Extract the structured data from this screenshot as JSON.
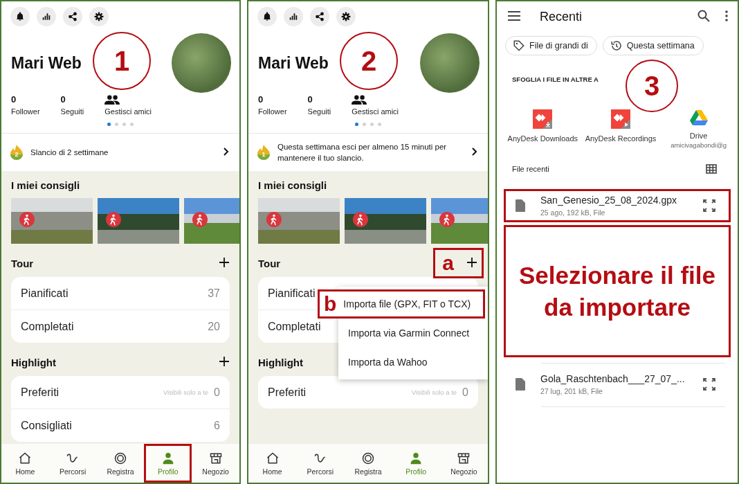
{
  "panels": [
    {
      "kind": "profile",
      "step": "1",
      "name": "Mari Web",
      "stats": [
        {
          "value": "0",
          "label": "Follower"
        },
        {
          "value": "0",
          "label": "Seguiti"
        }
      ],
      "friends": "Gestisci amici",
      "pager": [
        {
          "selected": true
        },
        {
          "selected": false
        },
        {
          "selected": false
        },
        {
          "selected": false
        }
      ],
      "streak": {
        "badge": "2",
        "text": "Slancio di 2 settimane"
      },
      "recommendations_title": "I miei consigli",
      "sections": [
        {
          "title": "Tour",
          "add_button": true,
          "rows": [
            {
              "label": "Pianificati",
              "count": "37"
            },
            {
              "label": "Completati",
              "count": "20"
            }
          ]
        },
        {
          "title": "Highlight",
          "add_button": true,
          "rows": [
            {
              "label": "Preferiti",
              "note": "Visibili solo a te",
              "count": "0"
            },
            {
              "label": "Consigliati",
              "count": "6"
            }
          ]
        }
      ],
      "nav": [
        {
          "label": "Home",
          "selected": false,
          "annotated": false
        },
        {
          "label": "Percorsi",
          "selected": false,
          "annotated": false
        },
        {
          "label": "Registra",
          "selected": false,
          "annotated": false
        },
        {
          "label": "Profilo",
          "selected": true,
          "annotated": true
        },
        {
          "label": "Negozio",
          "selected": false,
          "annotated": false
        }
      ]
    },
    {
      "kind": "profile",
      "step": "2",
      "name": "Mari Web",
      "stats": [
        {
          "value": "0",
          "label": "Follower"
        },
        {
          "value": "0",
          "label": "Seguiti"
        }
      ],
      "friends": "Gestisci amici",
      "pager": [
        {
          "selected": true
        },
        {
          "selected": false
        },
        {
          "selected": false
        },
        {
          "selected": false
        }
      ],
      "streak": {
        "badge": "1",
        "text": "Questa settimana esci per almeno 15 minuti per mantenere il tuo slancio."
      },
      "recommendations_title": "I miei consigli",
      "sections": [
        {
          "title": "Tour",
          "add_button": true,
          "callout": "a",
          "rows": [
            {
              "label": "Pianificati"
            },
            {
              "label": "Completati"
            }
          ],
          "menu": [
            {
              "label": "Importa file (GPX, FIT o TCX)",
              "callout": "b"
            },
            {
              "label": "Importa via Garmin Connect"
            },
            {
              "label": "Importa da Wahoo"
            }
          ]
        },
        {
          "title": "Highlight",
          "add_button": false,
          "rows": [
            {
              "label": "Preferiti",
              "note": "Visibili solo a te",
              "count": "0"
            }
          ]
        }
      ],
      "nav": [
        {
          "label": "Home",
          "selected": false,
          "annotated": false
        },
        {
          "label": "Percorsi",
          "selected": false,
          "annotated": false
        },
        {
          "label": "Registra",
          "selected": false,
          "annotated": false
        },
        {
          "label": "Profilo",
          "selected": true,
          "annotated": false
        },
        {
          "label": "Negozio",
          "selected": false,
          "annotated": false
        }
      ]
    },
    {
      "kind": "files",
      "step": "3",
      "title": "Recenti",
      "chips": [
        {
          "kind": "tag",
          "label": "File di grandi di"
        },
        {
          "kind": "history",
          "label": "Questa settimana"
        }
      ],
      "browse_title": "SFOGLIA I FILE IN ALTRE A",
      "apps": [
        {
          "kind": "anydesk-downloads",
          "label": "AnyDesk Downloads"
        },
        {
          "kind": "anydesk-recordings",
          "label": "AnyDesk Recordings"
        },
        {
          "kind": "drive",
          "label": "Drive",
          "account": "amicivagabondi@g"
        }
      ],
      "recent_title": "File recenti",
      "files": [
        {
          "name": "San_Genesio_25_08_2024.gpx",
          "meta": "25 ago, 192 kB, File",
          "annotated": true
        },
        {
          "name": "Gola_Raschtenbach___27_07_...",
          "meta": "27 lug, 201 kB, File",
          "annotated": false
        }
      ],
      "instruction": "Selezionare il file da importare"
    }
  ]
}
